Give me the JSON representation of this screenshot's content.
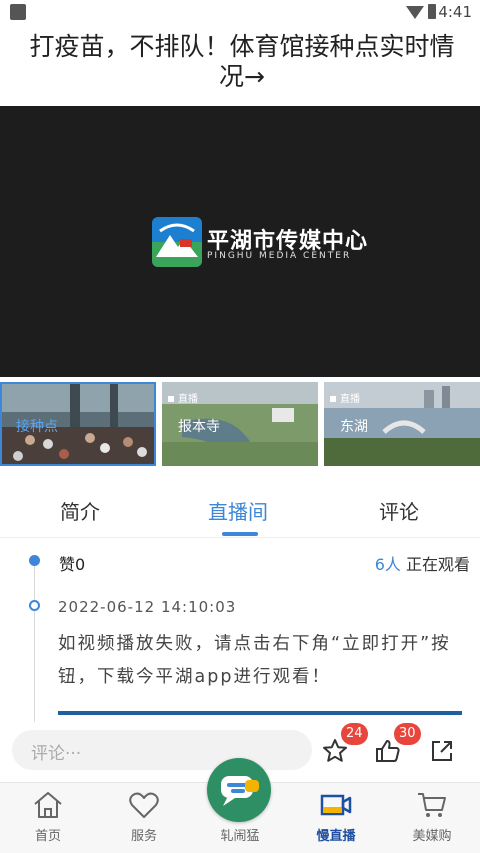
{
  "status_bar": {
    "time": "4:41"
  },
  "article": {
    "title": "打疫苗，不排队！体育馆接种点实时情况→"
  },
  "player": {
    "logo_name_cn": "平湖市传媒中心",
    "logo_name_en": "PINGHU MEDIA CENTER"
  },
  "thumbnails": [
    {
      "badge": "",
      "label": "接种点",
      "active": true
    },
    {
      "badge": "直播",
      "label": "报本寺",
      "active": false
    },
    {
      "badge": "直播",
      "label": "东湖",
      "active": false
    }
  ],
  "tabs": [
    {
      "label": "简介",
      "active": false
    },
    {
      "label": "直播间",
      "active": true
    },
    {
      "label": "评论",
      "active": false
    }
  ],
  "live_room": {
    "likes_label": "赞0",
    "viewer_count": "6人",
    "viewer_suffix": "正在观看",
    "post": {
      "time": "2022-06-12 14:10:03",
      "text": "如视频播放失败，请点击右下角“立即打开”按钮，下载今平湖app进行观看！"
    }
  },
  "comment_bar": {
    "placeholder": "评论···",
    "favorite_count": "24",
    "like_count": "30"
  },
  "bottom_nav": {
    "items": [
      {
        "label": "首页",
        "icon": "home-icon",
        "active": false
      },
      {
        "label": "服务",
        "icon": "heart-icon",
        "active": false
      },
      {
        "label": "轧闹猛",
        "icon": "chat-icon",
        "active": false
      },
      {
        "label": "慢直播",
        "icon": "video-camera-icon",
        "active": true
      },
      {
        "label": "美媒购",
        "icon": "cart-icon",
        "active": false
      }
    ]
  },
  "colors": {
    "accent": "#3d86d8",
    "active_nav": "#1e4fa0",
    "badge": "#e8453c",
    "center_button": "#2f8f64"
  }
}
